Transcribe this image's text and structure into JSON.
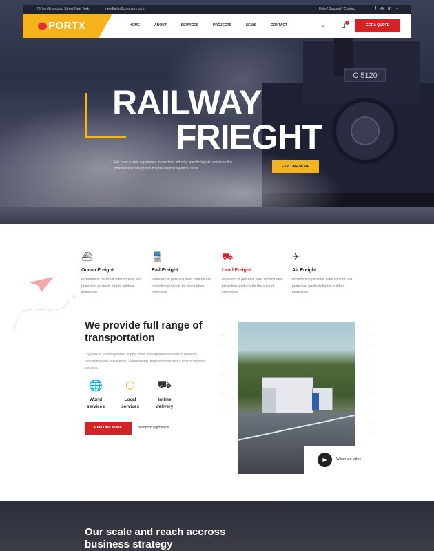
{
  "topbar": {
    "address": "76 San Francisco Street New York",
    "email": "needhelp@company.com",
    "links": "Help  /  Support  /  Contact"
  },
  "brand": {
    "name": "PORTX"
  },
  "nav": {
    "items": [
      "HOME",
      "ABOUT",
      "SERVICES",
      "PROJECTS",
      "NEWS",
      "CONTACT"
    ],
    "cart_count": "0",
    "quote": "GET A QUOTE"
  },
  "hero": {
    "line1": "RAILWAY",
    "line2": "FRIEGHT",
    "text": "We have a wide experience in overland industry specific logistic solutions like pharmaceutical logistics pharmaceutical logistics, retail",
    "button": "EXPLORE MORE",
    "loco_plate": "C 5120"
  },
  "services": [
    {
      "icon": "ship-icon",
      "title": "Ocean Freight",
      "desc": "Providers of personal safet comfort and protection products for the outdoor enthusiast"
    },
    {
      "icon": "train-icon",
      "title": "Rail Freight",
      "desc": "Providers of personal safet comfort and protection products for the outdoor enthusiast"
    },
    {
      "icon": "truck-icon",
      "title": "Land Freight",
      "desc": "Providers of personal safet comfort and protection products for the outdoor enthusiast"
    },
    {
      "icon": "plane-icon",
      "title": "Air Freight",
      "desc": "Providers of personal safet comfort and protection products for the outdoor enthusiast"
    }
  ],
  "transport": {
    "heading": "We provide full range of transportation",
    "text": "Logistick is a distinguished supply chain management firm which provides comprehensive solutions for warehousing, transportation and a host of logistics services.",
    "features": [
      {
        "icon": "globe-icon",
        "label": "World services"
      },
      {
        "icon": "box-icon",
        "label": "Local services"
      },
      {
        "icon": "delivery-truck-icon",
        "label": "Intime delivery"
      }
    ],
    "button": "EXPLORE MORE",
    "email": "helloportx@gmail.co",
    "video": "Watch our video"
  },
  "bottom": {
    "heading": "Our scale and reach accross business strategy"
  },
  "colors": {
    "accent": "#f5b41e",
    "brand_red": "#d42327",
    "dark": "#2b2e3b"
  }
}
